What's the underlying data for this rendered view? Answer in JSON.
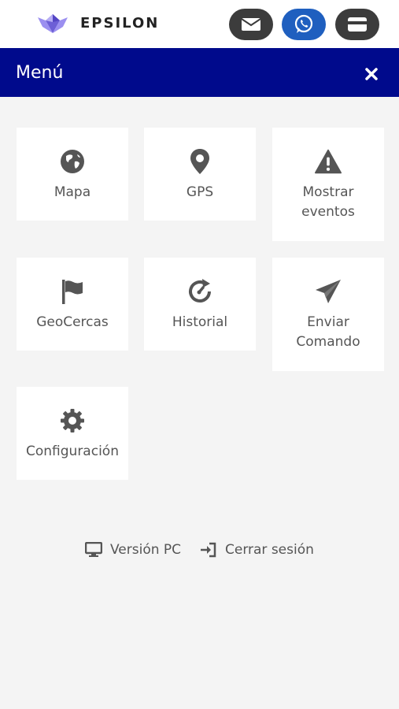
{
  "header": {
    "brand": "EPSILON",
    "buttons": [
      {
        "name": "mail",
        "icon": "envelope-icon"
      },
      {
        "name": "whatsapp",
        "icon": "whatsapp-icon"
      },
      {
        "name": "card",
        "icon": "card-icon"
      }
    ],
    "colors": {
      "dark_pill": "#3c3c3c",
      "whatsapp_pill": "#1f5fbf"
    }
  },
  "menu": {
    "title": "Menú",
    "close_icon": "close-icon",
    "bar_color": "#000a8c",
    "items": [
      {
        "label": "Mapa",
        "icon": "globe-icon"
      },
      {
        "label": "GPS",
        "icon": "map-pin-icon"
      },
      {
        "label": "Mostrar eventos",
        "icon": "warning-icon"
      },
      {
        "label": "GeoCercas",
        "icon": "flag-icon"
      },
      {
        "label": "Historial",
        "icon": "history-icon"
      },
      {
        "label": "Enviar Comando",
        "icon": "send-icon"
      },
      {
        "label": "Configuración",
        "icon": "gear-icon"
      }
    ]
  },
  "footer": {
    "pc_version": {
      "label": "Versión PC",
      "icon": "monitor-icon"
    },
    "logout": {
      "label": "Cerrar sesión",
      "icon": "sign-out-icon"
    }
  }
}
